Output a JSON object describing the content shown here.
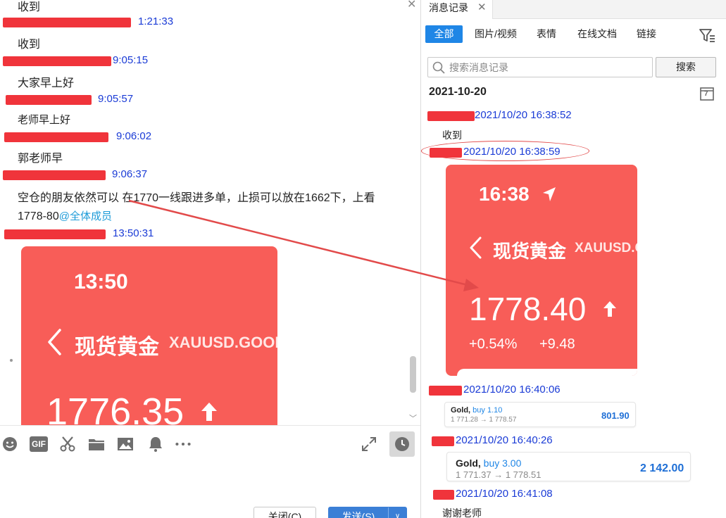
{
  "left_chat": {
    "partial_top_message": "收到",
    "messages": [
      {
        "time": "1:21:33",
        "text": "收到"
      },
      {
        "time": "9:05:15",
        "text": "大家早上好"
      },
      {
        "time": "9:05:57",
        "text": "老师早上好"
      },
      {
        "time": "9:06:02",
        "text": "郭老师早"
      },
      {
        "time": "9:06:37",
        "text_line1": "空仓的朋友依然可以 在1770一线跟进多单，止损可以放在1662下，上看",
        "text_line2": "1778-80",
        "mention": "@全体成员"
      },
      {
        "time": "13:50:31"
      }
    ],
    "image_card": {
      "time": "13:50",
      "title": "现货黄金",
      "code": "XAUUSD.GOOD",
      "price": "1776.35"
    },
    "toolbar_icons": [
      "smiley-icon",
      "gif-icon",
      "scissors-icon",
      "folder-icon",
      "image-icon",
      "bell-icon",
      "more-icon",
      "expand-icon",
      "clock-icon"
    ],
    "toolbar_gif_label": "GIF",
    "close_button": "关闭(C)",
    "send_button": "发送(S)"
  },
  "history": {
    "tab_label": "消息记录",
    "filter_tabs": [
      "全部",
      "图片/视频",
      "表情",
      "在线文档",
      "链接"
    ],
    "active_filter": "全部",
    "search_placeholder": "搜索消息记录",
    "search_button": "搜索",
    "date_heading": "2021-10-20",
    "calendar_day": "7",
    "entries": [
      {
        "timestamp": "2021/10/20 16:38:52",
        "text": "收到"
      },
      {
        "timestamp": "2021/10/20 16:38:59"
      },
      {
        "timestamp": "2021/10/20 16:40:06"
      },
      {
        "timestamp": "2021/10/20 16:40:26"
      },
      {
        "timestamp": "2021/10/20 16:41:08",
        "text": "谢谢老师"
      }
    ],
    "image_card": {
      "time": "16:38",
      "title": "现货黄金",
      "code": "XAUUSD.G",
      "price": "1778.40",
      "change_pct": "+0.54%",
      "change_abs": "+9.48"
    },
    "trades": [
      {
        "symbol": "Gold,",
        "side": "buy 1.10",
        "prices": "1 771.28 → 1 778.57",
        "pl": "801.90"
      },
      {
        "symbol": "Gold,",
        "side": "buy 3.00",
        "prices": "1 771.37 → 1 778.51",
        "pl": "2 142.00"
      }
    ]
  },
  "colors": {
    "card_red": "#f85d58",
    "timestamp_blue": "#1a3bd6",
    "redaction_red": "#f0343b",
    "annotation_red": "#e24a4a",
    "tab_active_blue": "#1f86e6"
  }
}
